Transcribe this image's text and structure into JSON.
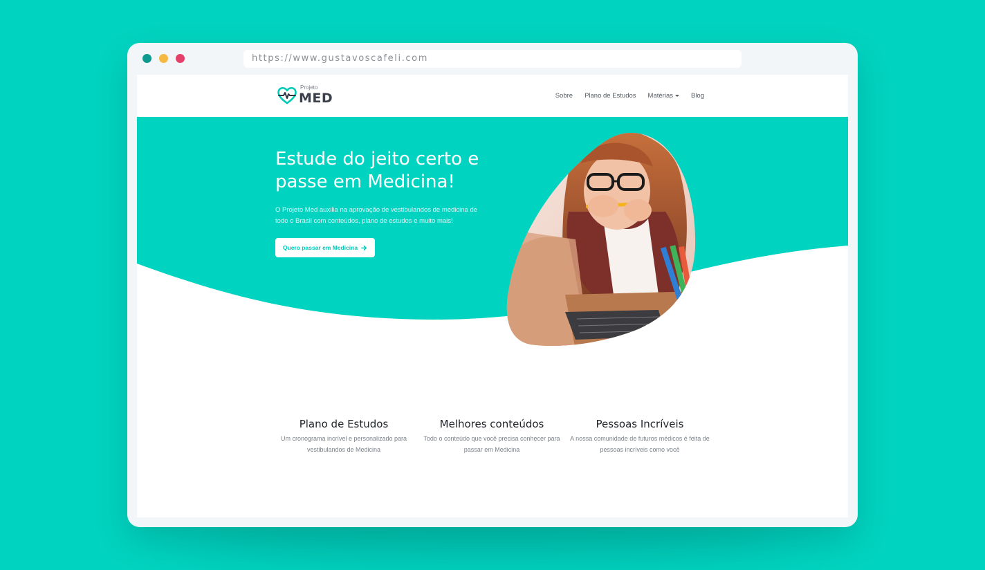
{
  "browser": {
    "url": "https://www.gustavoscafeli.com"
  },
  "brand": {
    "small": "Projeto",
    "big": "MED",
    "accent": "#00d4c1"
  },
  "nav": {
    "items": [
      {
        "label": "Sobre"
      },
      {
        "label": "Plano de Estudos"
      },
      {
        "label": "Matérias"
      },
      {
        "label": "Blog"
      }
    ]
  },
  "hero": {
    "title": "Estude do jeito certo e passe em Medicina!",
    "text": "O Projeto Med auxilia na aprovação de vestibulandos de medicina de todo o Brasil com conteúdos, plano de estudos e muito mais!",
    "cta_label": "Quero passar em Medicina",
    "cta_icon": "arrow-right-icon"
  },
  "features": [
    {
      "title": "Plano de Estudos",
      "text": "Um cronograma incrível e personalizado para vestibulandos de Medicina"
    },
    {
      "title": "Melhores conteúdos",
      "text": "Todo o conteúdo que você precisa conhecer para passar em Medicina"
    },
    {
      "title": "Pessoas Incríveis",
      "text": "A nossa comunidade de futuros médicos é feita de pessoas incríveis como você"
    }
  ]
}
